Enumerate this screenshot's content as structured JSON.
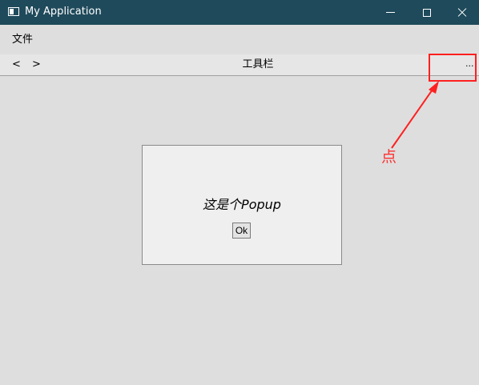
{
  "window": {
    "title": "My Application",
    "icon": "window-icon",
    "controls": [
      "minimize-icon",
      "maximize-icon",
      "close-icon"
    ]
  },
  "menubar": {
    "items": [
      {
        "label": "文件"
      }
    ]
  },
  "toolbar": {
    "prev_label": "<",
    "next_label": ">",
    "title": "工具栏",
    "overflow_label": "..."
  },
  "popup": {
    "message": "这是个Popup",
    "ok_label": "Ok"
  },
  "annotation": {
    "text": "点",
    "color": "#ff2020"
  }
}
